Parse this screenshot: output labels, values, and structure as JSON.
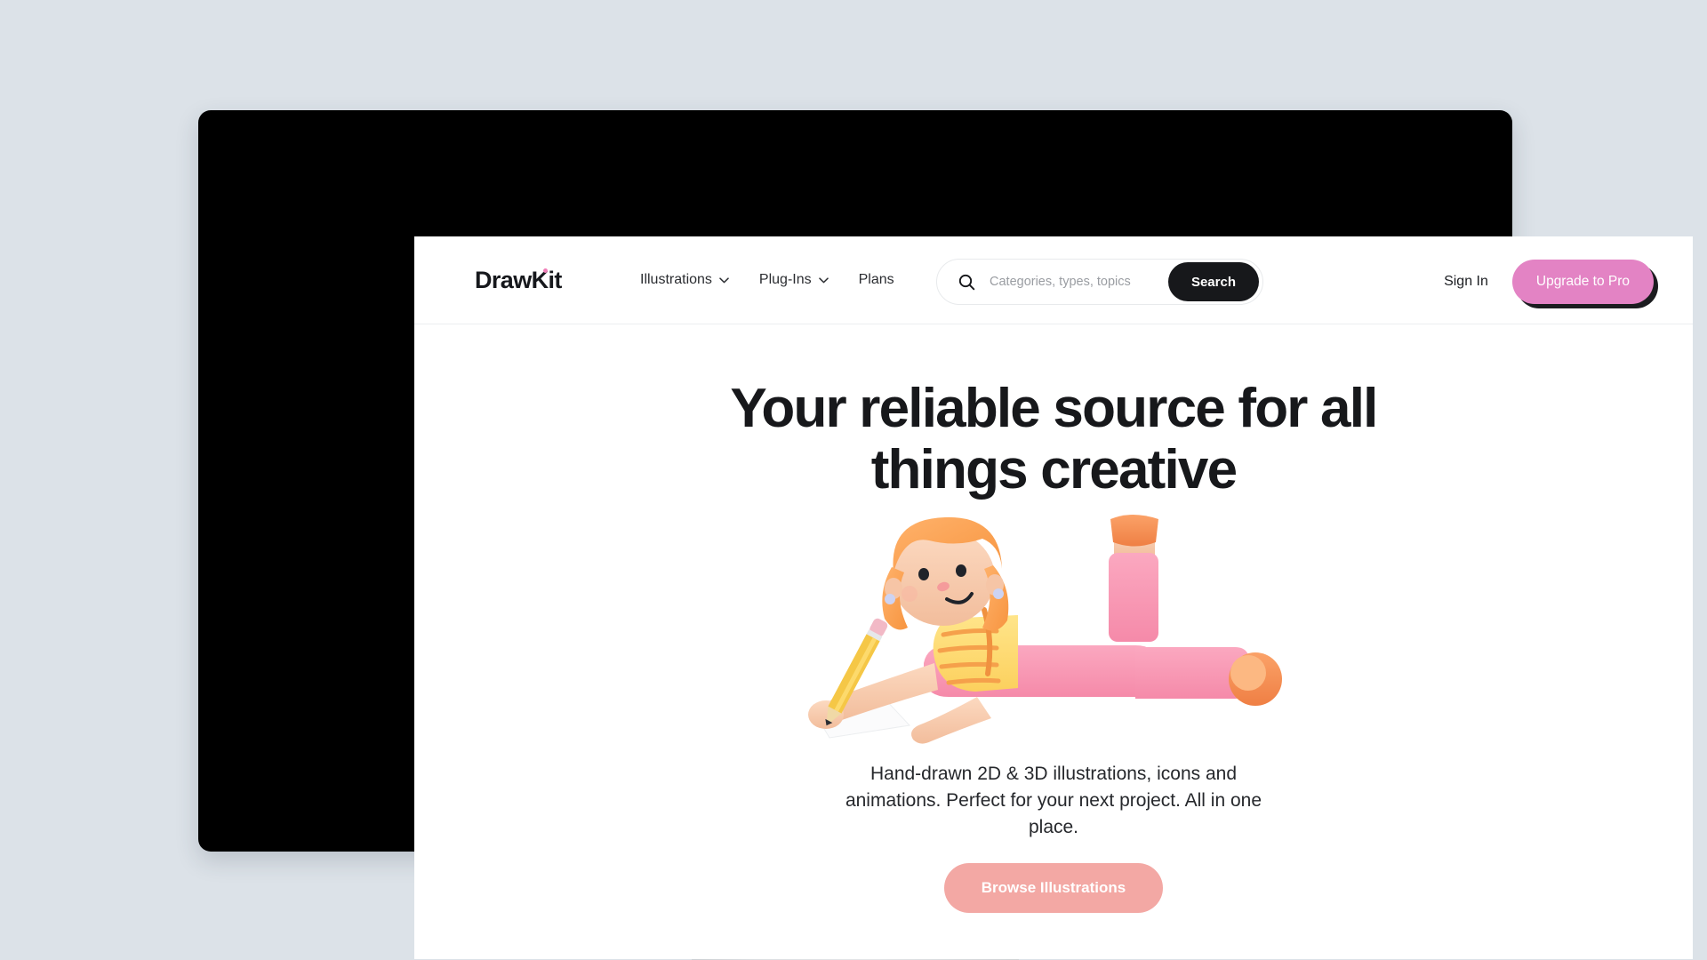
{
  "background_color": "#dce2e8",
  "device": {
    "type": "desktop-monitor",
    "bezel_color": "#000000",
    "stand_color": "#d6d9dc"
  },
  "site": {
    "header": {
      "logo_text": "DrawKit",
      "logo_dot_color": "#f07eb8",
      "nav": [
        {
          "label": "Illustrations",
          "has_dropdown": true
        },
        {
          "label": "Plug-Ins",
          "has_dropdown": true
        },
        {
          "label": "Plans",
          "has_dropdown": false
        }
      ],
      "search": {
        "icon": "search-icon",
        "value": "",
        "placeholder": "Categories, types, topics",
        "button_label": "Search",
        "button_color": "#17181b"
      },
      "sign_in_label": "Sign In",
      "upgrade_label": "Upgrade to Pro",
      "upgrade_color": "#e383c4"
    },
    "hero": {
      "headline": "Your reliable source for all things creative",
      "illustration": "girl-drawing-3d-illustration",
      "subtext": "Hand-drawn 2D & 3D illustrations, icons and animations. Perfect for your next project. All in one place.",
      "cta_label": "Browse Illustrations",
      "cta_color": "#f3a8a4"
    }
  }
}
